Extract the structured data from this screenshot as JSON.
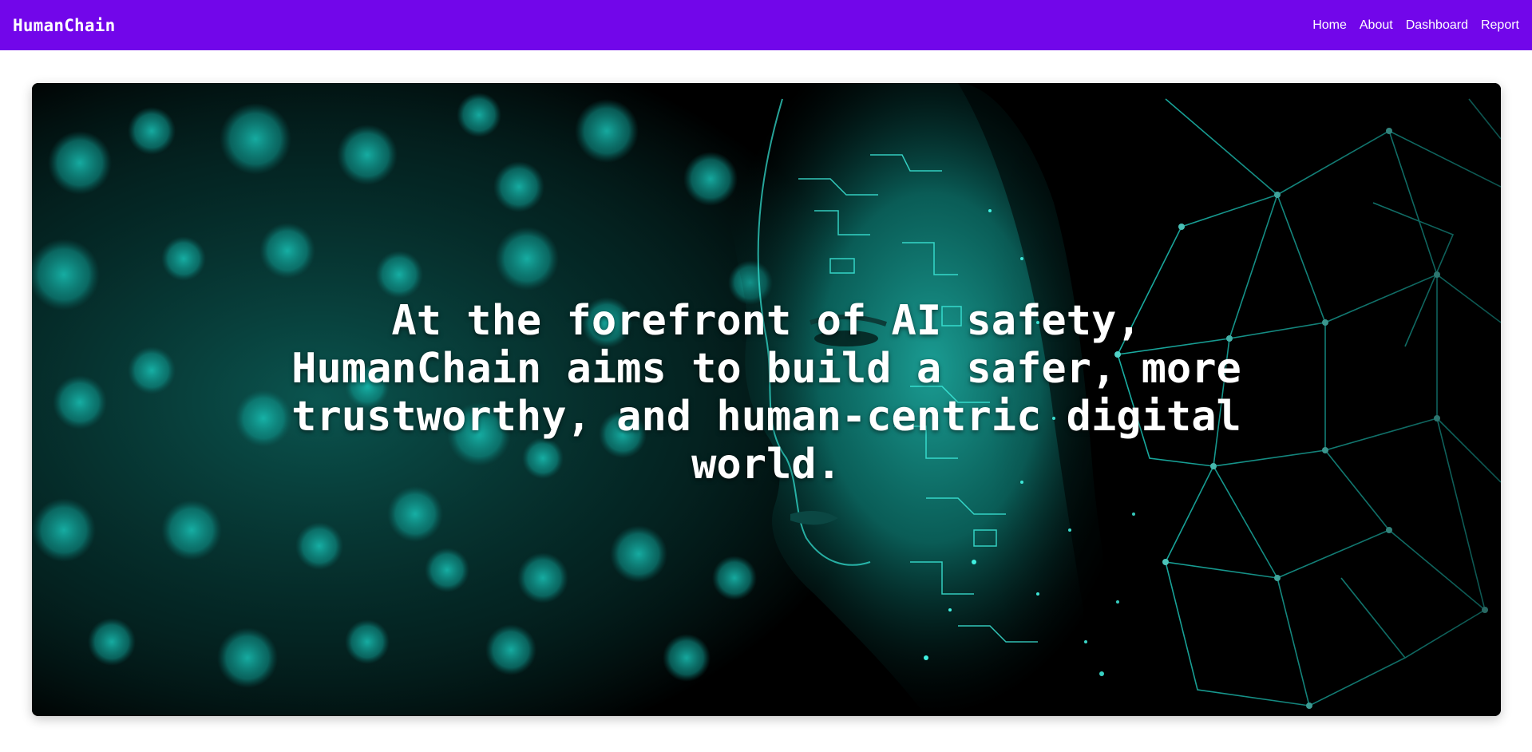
{
  "navbar": {
    "brand": "HumanChain",
    "links": [
      {
        "label": "Home"
      },
      {
        "label": "About"
      },
      {
        "label": "Dashboard"
      },
      {
        "label": "Report"
      }
    ],
    "background_color": "#7206ea"
  },
  "hero": {
    "image_description_icon": "ai-face-network-image",
    "headline": "At the forefront of AI safety, HumanChain aims to build a safer, more trustworthy, and human-centric digital world.",
    "accent_color": "#00e6d8"
  }
}
